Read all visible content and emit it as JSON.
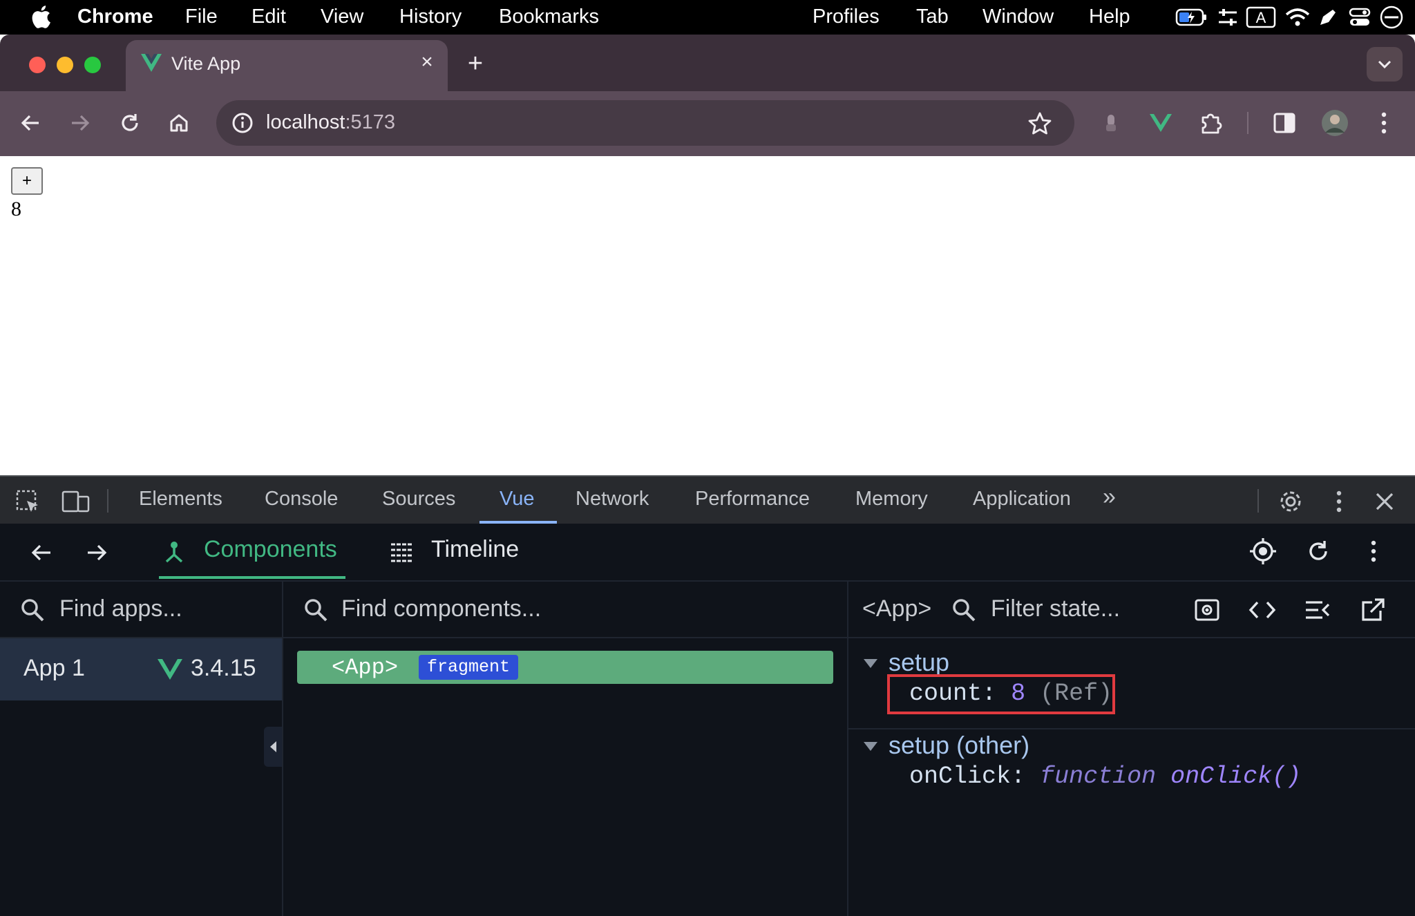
{
  "menubar": {
    "app": "Chrome",
    "items": [
      "File",
      "Edit",
      "View",
      "History",
      "Bookmarks",
      "Profiles",
      "Tab",
      "Window",
      "Help"
    ],
    "status_icons": [
      "battery-charging-icon",
      "control-sliders-icon",
      "input-source-icon",
      "wifi-icon",
      "pen-icon",
      "control-center-icon",
      "focus-icon"
    ],
    "input_source_label": "A"
  },
  "browser": {
    "tab_title": "Vite App",
    "tab_close": "×",
    "new_tab": "+",
    "url_host": "localhost",
    "url_port": ":5173"
  },
  "page": {
    "button_label": "+",
    "count_value": "8"
  },
  "devtools": {
    "tabs": [
      "Elements",
      "Console",
      "Sources",
      "Vue",
      "Network",
      "Performance",
      "Memory",
      "Application"
    ],
    "active_tab": "Vue",
    "more_tabs": "»"
  },
  "vue": {
    "components_tab": "Components",
    "timeline_tab": "Timeline",
    "find_apps_placeholder": "Find apps...",
    "find_components_placeholder": "Find components...",
    "filter_state_placeholder": "Filter state...",
    "app_name": "App 1",
    "vue_version": "3.4.15",
    "component_tag": "<App>",
    "component_badge": "fragment",
    "selected_component": "<App>",
    "state": {
      "setup_label": "setup",
      "count_key": "count",
      "count_colon": ":",
      "count_value": "8",
      "count_type": "(Ref)",
      "setup_other_label": "setup (other)",
      "onclick_key": "onClick",
      "onclick_colon": ":",
      "onclick_kw": "function",
      "onclick_value": "onClick()"
    }
  },
  "colors": {
    "vue_green": "#41b883",
    "highlight_red": "#e03a3f",
    "active_tab_blue": "#8ab4f8"
  }
}
